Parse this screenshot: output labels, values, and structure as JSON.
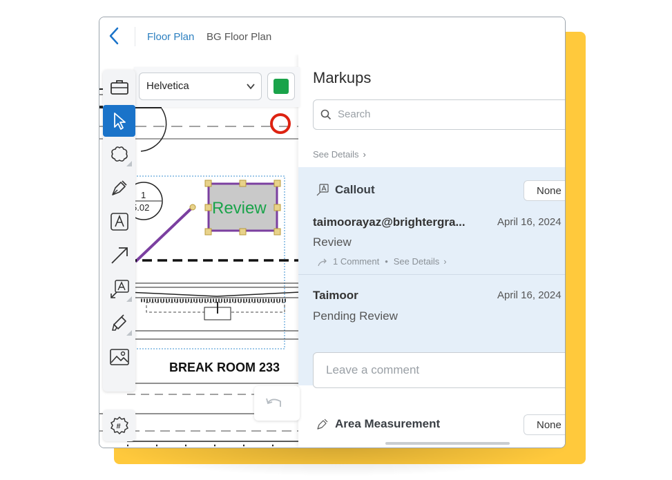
{
  "breadcrumb": {
    "back_icon": "chevron-left-icon",
    "item1": "Floor Plan",
    "item2": "BG Floor Plan"
  },
  "font_toolbar": {
    "font": "Helvetica",
    "color": "#1aa34a"
  },
  "plan": {
    "markup_label": "Review",
    "room_label": "BREAK ROOM  233",
    "detail_top": "1",
    "detail_bottom": "5.02"
  },
  "tools": [
    "briefcase-icon",
    "select-cursor-icon",
    "cloud-icon",
    "pen-icon",
    "text-icon",
    "arrow-icon",
    "callout-icon",
    "highlighter-icon",
    "image-icon",
    "settings-icon"
  ],
  "panel": {
    "title": "Markups",
    "search_placeholder": "Search",
    "see_details": "See Details",
    "callout": {
      "type": "Callout",
      "badge": "None",
      "author": "taimoorayaz@brightergra...",
      "date": "April 16, 2024",
      "text": "Review",
      "comments": "1 Comment",
      "see_details": "See Details",
      "reply": {
        "author": "Taimoor",
        "date": "April 16, 2024",
        "text": "Pending Review"
      },
      "comment_placeholder": "Leave a comment"
    },
    "area": {
      "type": "Area Measurement",
      "badge": "None"
    }
  },
  "colors": {
    "accent": "#1a73c9",
    "selected_bg": "#e5eff9",
    "brand_yellow": "#FFC93C",
    "markup_purple": "#7b3fa0"
  }
}
